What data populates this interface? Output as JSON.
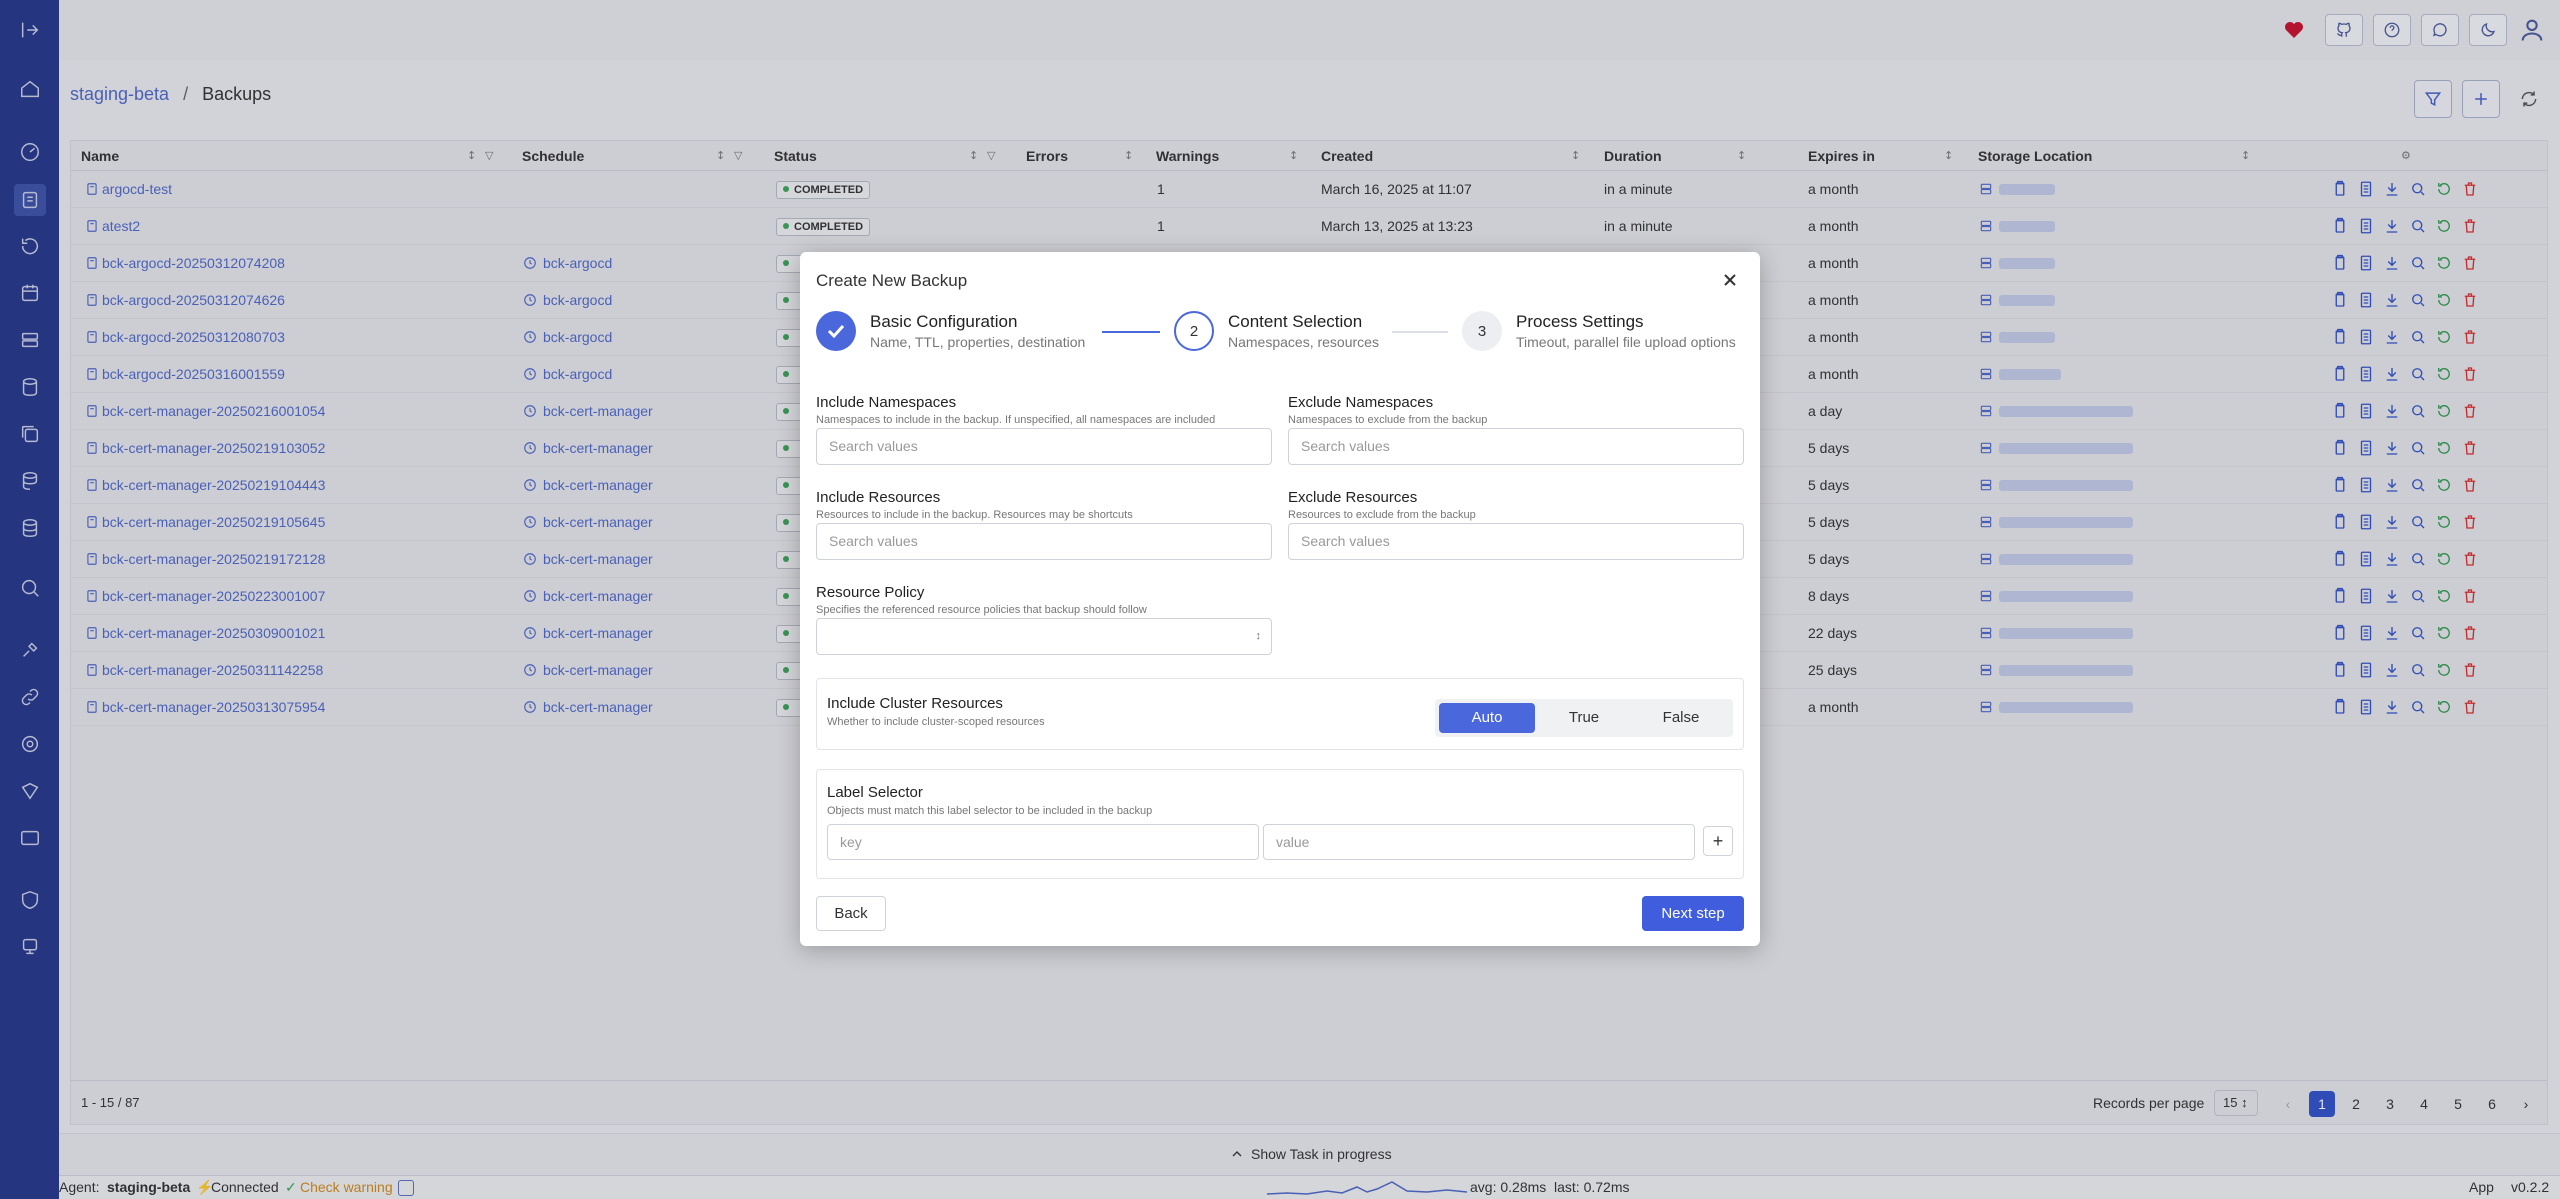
{
  "breadcrumb": {
    "cluster": "staging-beta",
    "sep": "/",
    "page": "Backups"
  },
  "columns": [
    "Name",
    "Schedule",
    "Status",
    "Errors",
    "Warnings",
    "Created",
    "Duration",
    "Expires in",
    "Storage Location"
  ],
  "rows": [
    {
      "name": "argocd-test",
      "schedule": "",
      "status": "COMPLETED",
      "warnings": "1",
      "created": "March 16, 2025 at 11:07",
      "duration": "in a minute",
      "expires": "a month"
    },
    {
      "name": "atest2",
      "schedule": "",
      "status": "COMPLETED",
      "warnings": "1",
      "created": "March 13, 2025 at 13:23",
      "duration": "in a minute",
      "expires": "a month"
    },
    {
      "name": "bck-argocd-20250312074208",
      "schedule": "bck-argocd",
      "expires": "a month"
    },
    {
      "name": "bck-argocd-20250312074626",
      "schedule": "bck-argocd",
      "expires": "a month"
    },
    {
      "name": "bck-argocd-20250312080703",
      "schedule": "bck-argocd",
      "expires": "a month"
    },
    {
      "name": "bck-argocd-20250316001559",
      "schedule": "bck-argocd",
      "expires": "a month"
    },
    {
      "name": "bck-cert-manager-20250216001054",
      "schedule": "bck-cert-manager",
      "expires": "a day"
    },
    {
      "name": "bck-cert-manager-20250219103052",
      "schedule": "bck-cert-manager",
      "expires": "5 days"
    },
    {
      "name": "bck-cert-manager-20250219104443",
      "schedule": "bck-cert-manager",
      "expires": "5 days"
    },
    {
      "name": "bck-cert-manager-20250219105645",
      "schedule": "bck-cert-manager",
      "expires": "5 days"
    },
    {
      "name": "bck-cert-manager-20250219172128",
      "schedule": "bck-cert-manager",
      "expires": "5 days"
    },
    {
      "name": "bck-cert-manager-20250223001007",
      "schedule": "bck-cert-manager",
      "expires": "8 days"
    },
    {
      "name": "bck-cert-manager-20250309001021",
      "schedule": "bck-cert-manager",
      "expires": "22 days"
    },
    {
      "name": "bck-cert-manager-20250311142258",
      "schedule": "bck-cert-manager",
      "expires": "25 days"
    },
    {
      "name": "bck-cert-manager-20250313075954",
      "schedule": "bck-cert-manager",
      "expires": "a month"
    }
  ],
  "footer": {
    "range": "1 - 15 / 87",
    "records_label": "Records per page",
    "per_page": "15",
    "pages": [
      "1",
      "2",
      "3",
      "4",
      "5",
      "6"
    ],
    "prev": "‹",
    "next": "›"
  },
  "task": {
    "label": "Show Task in progress"
  },
  "status": {
    "agent_label": "Agent:",
    "agent": "staging-beta",
    "connected": "Connected",
    "check": "Check warning",
    "avg": "avg: 0.28ms",
    "last": "last: 0.72ms",
    "app": "App",
    "version": "v0.2.2"
  },
  "modal": {
    "title": "Create New Backup",
    "steps": [
      {
        "num": "",
        "title": "Basic Configuration",
        "sub": "Name, TTL, properties, destination"
      },
      {
        "num": "2",
        "title": "Content Selection",
        "sub": "Namespaces, resources"
      },
      {
        "num": "3",
        "title": "Process Settings",
        "sub": "Timeout, parallel file upload options"
      }
    ],
    "include_ns": {
      "label": "Include Namespaces",
      "desc": "Namespaces to include in the backup. If unspecified, all namespaces are included",
      "placeholder": "Search values"
    },
    "exclude_ns": {
      "label": "Exclude Namespaces",
      "desc": "Namespaces to exclude from the backup",
      "placeholder": "Search values"
    },
    "include_res": {
      "label": "Include Resources",
      "desc": "Resources to include in the backup. Resources may be shortcuts",
      "placeholder": "Search values"
    },
    "exclude_res": {
      "label": "Exclude Resources",
      "desc": "Resources to exclude from the backup",
      "placeholder": "Search values"
    },
    "policy": {
      "label": "Resource Policy",
      "desc": "Specifies the referenced resource policies that backup should follow"
    },
    "cluster": {
      "label": "Include Cluster Resources",
      "desc": "Whether to include cluster-scoped resources",
      "options": [
        "Auto",
        "True",
        "False"
      ],
      "selected": "Auto"
    },
    "label_sel": {
      "label": "Label Selector",
      "desc": "Objects must match this label selector to be included in the backup",
      "key_ph": "key",
      "value_ph": "value",
      "add": "+"
    },
    "back": "Back",
    "next": "Next step"
  },
  "colors": {
    "sidebar": "#263789",
    "accent": "#3f5ddc",
    "link": "#4f68c9",
    "success": "#3ca35b",
    "danger": "#d92d2d"
  }
}
